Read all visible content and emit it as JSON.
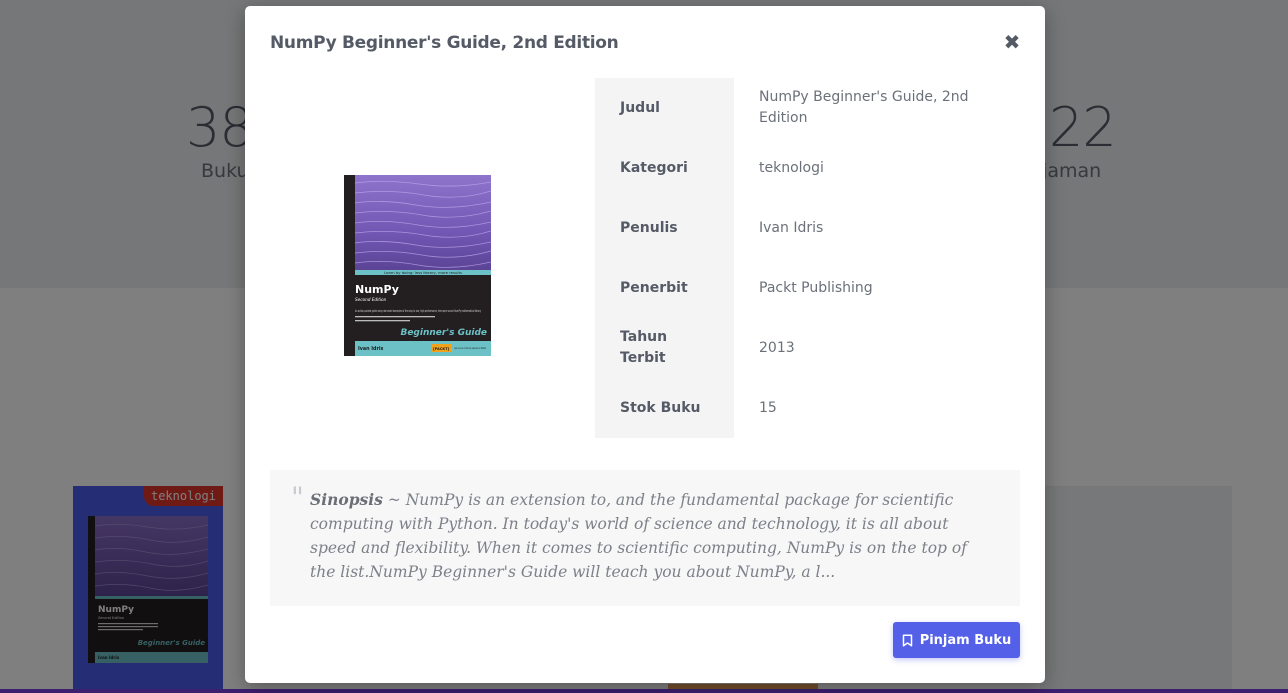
{
  "background": {
    "stat_left": {
      "number": "38",
      "label": "Buku"
    },
    "stat_right": {
      "number": "22",
      "label": "njaman"
    },
    "card": {
      "tag": "teknologi"
    }
  },
  "modal": {
    "title": "NumPy Beginner's Guide, 2nd Edition",
    "close_icon": "close-icon",
    "cover": {
      "tagline": "Learn by doing: less theory, more results",
      "title": "NumPy",
      "edition": "Second Edition",
      "blurb": "An action-packed guide using real world examples of the easy to use, high performance, free open source NumPy mathematical library",
      "series": "Beginner's Guide",
      "author": "Ivan Idris",
      "publisher_mark": "[PACKT]",
      "publisher_note": "open source community experience distilled"
    },
    "details": [
      {
        "key": "Judul",
        "value": "NumPy Beginner's Guide, 2nd Edition"
      },
      {
        "key": "Kategori",
        "value": "teknologi"
      },
      {
        "key": "Penulis",
        "value": "Ivan Idris"
      },
      {
        "key": "Penerbit",
        "value": "Packt Publishing"
      },
      {
        "key": "Tahun Terbit",
        "value": "2013"
      },
      {
        "key": "Stok Buku",
        "value": "15"
      }
    ],
    "synopsis": {
      "label": "Sinopsis",
      "separator": " ~ ",
      "text": "NumPy is an extension to, and the fundamental package for scientific computing with Python. In today's world of science and technology, it is all about speed and flexibility. When it comes to scientific computing, NumPy is on the top of the list.NumPy Beginner's Guide will teach you about NumPy, a l..."
    },
    "borrow_button": {
      "label": "Pinjam Buku",
      "icon": "bookmark-icon"
    }
  },
  "colors": {
    "primary": "#5460e8",
    "tag_red": "#e0342c",
    "text_dark": "#555b66"
  }
}
